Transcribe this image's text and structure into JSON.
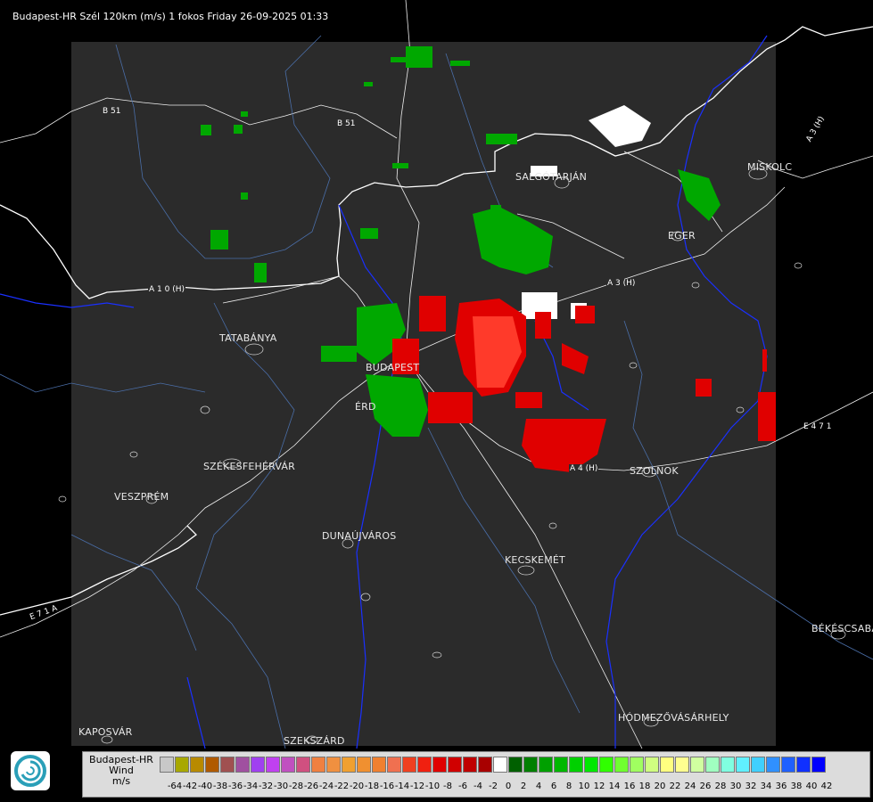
{
  "title": "Budapest-HR Szél 120km (m/s) 1 fokos Friday 26-09-2025 01:33",
  "cities": [
    {
      "key": "salgotarjan",
      "label": "SALGÓTARJÁN"
    },
    {
      "key": "miskolc",
      "label": "MISKOLC"
    },
    {
      "key": "eger",
      "label": "EGER"
    },
    {
      "key": "tatabanya",
      "label": "TATABÁNYA"
    },
    {
      "key": "budapest",
      "label": "BUDAPEST"
    },
    {
      "key": "erd",
      "label": "ÉRD"
    },
    {
      "key": "szekesfehervar",
      "label": "SZÉKESFEHÉRVÁR"
    },
    {
      "key": "veszprem",
      "label": "VESZPRÉM"
    },
    {
      "key": "dunaujvaros",
      "label": "DUNAÚJVÁROS"
    },
    {
      "key": "kecskemet",
      "label": "KECSKEMÉT"
    },
    {
      "key": "szolnok",
      "label": "SZOLNOK"
    },
    {
      "key": "bekescsaba",
      "label": "BÉKÉSCSABA"
    },
    {
      "key": "hodmezovasarhely",
      "label": "HÓDMEZŐVÁSÁRHELY"
    },
    {
      "key": "kaposvar",
      "label": "KAPOSVÁR"
    },
    {
      "key": "szekszard",
      "label": "SZEKSZÁRD"
    }
  ],
  "roads": [
    {
      "key": "b51a",
      "label": "B 51"
    },
    {
      "key": "b51b",
      "label": "B 51"
    },
    {
      "key": "a3h",
      "label": "A 3 (H)"
    },
    {
      "key": "a3h2",
      "label": "A 3 (H)"
    },
    {
      "key": "a10h",
      "label": "A 1 0 (H)"
    },
    {
      "key": "a4h",
      "label": "A 4 (H)"
    },
    {
      "key": "e471",
      "label": "E 4 7 1"
    },
    {
      "key": "e71",
      "label": "E 7 1 A"
    }
  ],
  "legend": {
    "name": "Budapest-HR",
    "quantity": "Wind",
    "unit": "m/s",
    "ticks": [
      "-64",
      "-42",
      "-40",
      "-38",
      "-36",
      "-34",
      "-32",
      "-30",
      "-28",
      "-26",
      "-24",
      "-22",
      "-20",
      "-18",
      "-16",
      "-14",
      "-12",
      "-10",
      "-8",
      "-6",
      "-4",
      "-2",
      "0",
      "2",
      "4",
      "6",
      "8",
      "10",
      "12",
      "14",
      "16",
      "18",
      "20",
      "22",
      "24",
      "26",
      "28",
      "30",
      "32",
      "34",
      "36",
      "38",
      "40",
      "42"
    ],
    "colors": [
      "#c8c8c8",
      "#a8a800",
      "#b88a00",
      "#b05a00",
      "#a05050",
      "#a050a0",
      "#a040f0",
      "#c040f0",
      "#c050c0",
      "#d05080",
      "#f08040",
      "#f09040",
      "#f0a030",
      "#f09030",
      "#f08030",
      "#f07050",
      "#f04020",
      "#f02010",
      "#e00000",
      "#d00000",
      "#c00000",
      "#a80000",
      "#ffffff",
      "#006000",
      "#008000",
      "#00a000",
      "#00b800",
      "#00d000",
      "#00e800",
      "#30ff00",
      "#70ff30",
      "#a0ff60",
      "#d0ff80",
      "#ffff80",
      "#ffff90",
      "#d0ffa0",
      "#a0ffc0",
      "#80ffe0",
      "#60f0ff",
      "#40d0ff",
      "#3090ff",
      "#2060ff",
      "#1030ff",
      "#0000ff"
    ]
  }
}
